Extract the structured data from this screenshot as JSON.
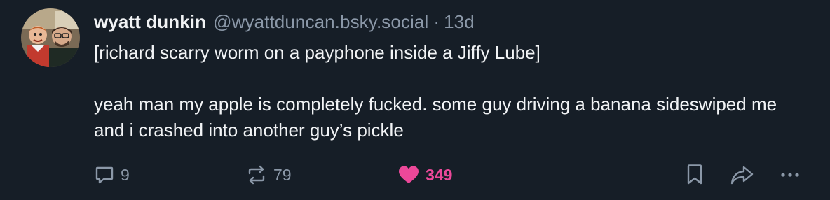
{
  "post": {
    "author": {
      "display_name": "wyatt dunkin",
      "handle": "@wyattduncan.bsky.social",
      "separator": "·",
      "age": "13d",
      "avatar_icon": "avatar-photo"
    },
    "text": {
      "paragraph_1": "[richard scarry worm on a payphone inside a Jiffy Lube]",
      "paragraph_2": "yeah man my apple is completely fucked. some guy driving a banana sideswiped me and i crashed into another guy’s pickle"
    },
    "actions": {
      "reply": {
        "icon": "reply-icon",
        "count": "9"
      },
      "repost": {
        "icon": "repost-icon",
        "count": "79"
      },
      "like": {
        "icon": "heart-icon",
        "count": "349",
        "liked": true
      },
      "bookmark": {
        "icon": "bookmark-icon"
      },
      "share": {
        "icon": "share-icon"
      },
      "more": {
        "icon": "more-icon"
      }
    },
    "colors": {
      "background": "#161e27",
      "text": "#f1f3f5",
      "muted": "#8b98a8",
      "like": "#ec4899"
    }
  }
}
